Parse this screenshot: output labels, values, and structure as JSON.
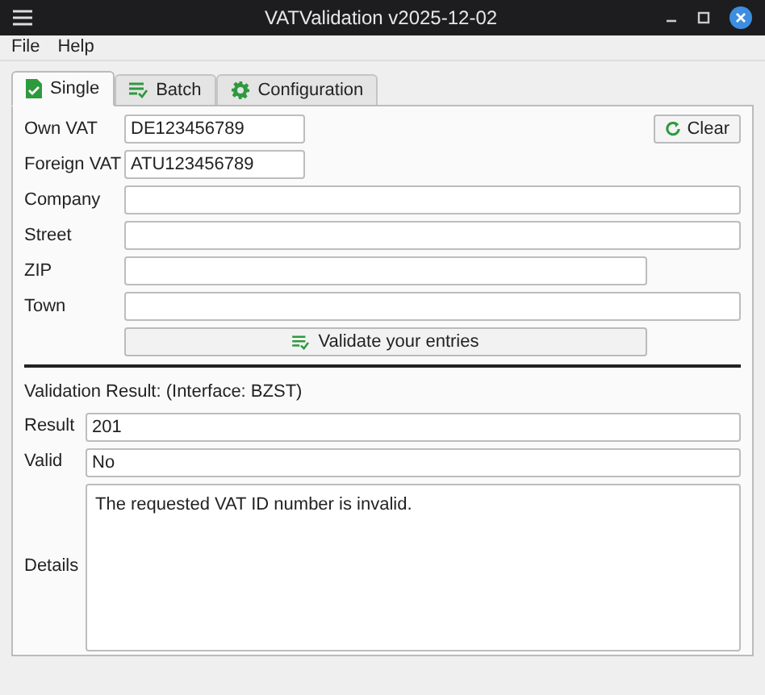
{
  "window": {
    "title": "VATValidation v2025-12-02"
  },
  "menu": [
    "File",
    "Help"
  ],
  "tabs": [
    {
      "label": "Single",
      "kind": "document",
      "selected": true
    },
    {
      "label": "Batch",
      "kind": "list",
      "selected": false
    },
    {
      "label": "Configuration",
      "kind": "gear",
      "selected": false
    }
  ],
  "form": {
    "fields": [
      {
        "label": "Own VAT",
        "value": "DE123456789",
        "kind": "short"
      },
      {
        "label": "Foreign VAT",
        "value": "ATU123456789",
        "kind": "short"
      },
      {
        "label": "Company",
        "kind": "full"
      },
      {
        "label": "Street",
        "kind": "full"
      },
      {
        "label": "ZIP",
        "kind": "medium"
      },
      {
        "label": "Town",
        "kind": "full"
      }
    ],
    "clear_button": "Clear",
    "validate_button": "Validate your entries"
  },
  "result": {
    "heading": "Validation Result: (Interface: BZST)",
    "fields": [
      {
        "label": "Result",
        "value": "201",
        "kind": "line"
      },
      {
        "label": "Valid",
        "value": "No",
        "kind": "line"
      },
      {
        "label": "Details",
        "value": "The requested VAT ID number is invalid.",
        "kind": "area"
      }
    ]
  }
}
